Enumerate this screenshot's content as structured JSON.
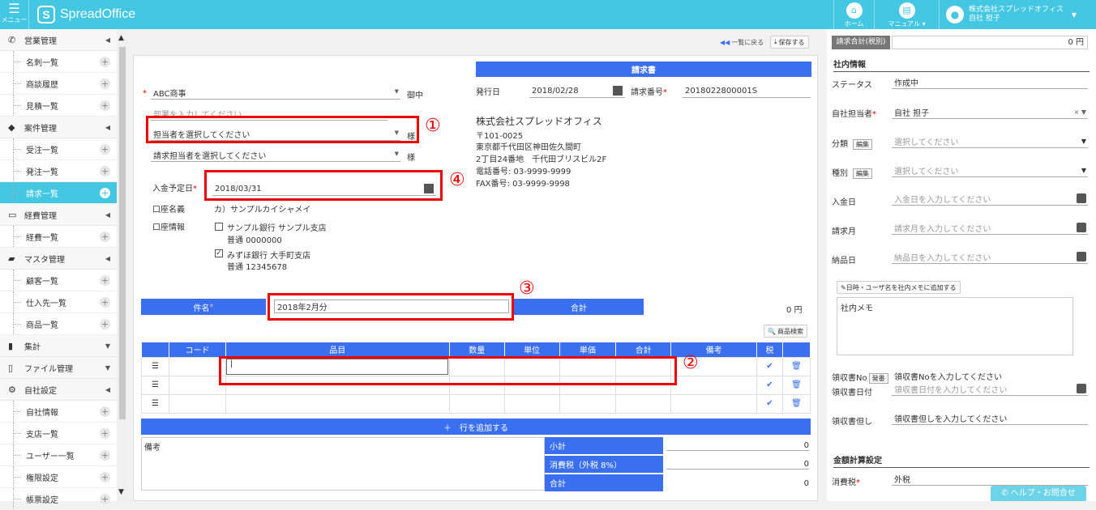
{
  "topbar": {
    "menu_label": "メニュー",
    "logo_text": "SpreadOffice",
    "logo_mark": "S",
    "home_label": "ホーム",
    "manual_label": "マニュアル ▾",
    "company": "株式会社スプレッドオフィス",
    "user": "自社 担子"
  },
  "sidebar": {
    "groups": [
      {
        "label": "営業管理",
        "icon": "phone-icon",
        "items": [
          "名刺一覧",
          "商談履歴",
          "見積一覧"
        ]
      },
      {
        "label": "案件管理",
        "icon": "tag-icon",
        "items": [
          "受注一覧",
          "発注一覧",
          "請求一覧"
        ]
      },
      {
        "label": "経費管理",
        "icon": "card-icon",
        "items": [
          "経費一覧"
        ]
      },
      {
        "label": "マスタ管理",
        "icon": "folder-icon",
        "items": [
          "顧客一覧",
          "仕入先一覧",
          "商品一覧"
        ]
      },
      {
        "label": "集計",
        "icon": "chart-icon",
        "items": []
      },
      {
        "label": "ファイル管理",
        "icon": "file-icon",
        "items": []
      },
      {
        "label": "自社設定",
        "icon": "gear-icon",
        "items": [
          "自社情報",
          "支店一覧",
          "ユーザー一覧",
          "権限設定",
          "帳票設定"
        ]
      }
    ],
    "active_item": "請求一覧"
  },
  "toolbar": {
    "back": "一覧に戻る",
    "save": "保存する"
  },
  "invoice": {
    "title": "請求書",
    "issue_date_label": "発行日",
    "issue_date": "2018/02/28",
    "number_label": "請求番号",
    "number": "2018022800001S",
    "customer": "ABC商事",
    "onchu": "御中",
    "dept_ph": "部署を入力してください",
    "contact_ph": "担当者を選択してください",
    "sama": "様",
    "billing_contact_ph": "請求担当者を選択してください",
    "company_name": "株式会社スプレッドオフィス",
    "postal": "〒101-0025",
    "addr1": "東京都千代田区神田佐久間町",
    "addr2": "2丁目24番地　千代田ブリスビル2F",
    "tel": "電話番号:  03-9999-9999",
    "fax": "FAX番号:  03-9999-9998",
    "pay_date_label": "入金予定日",
    "pay_date": "2018/03/31",
    "account_name_label": "口座名義",
    "account_name": "カ）サンプルカイシャメイ",
    "account_info_label": "口座情報",
    "bank1_line1": "サンプル銀行 サンプル支店",
    "bank1_line2": "普通 0000000",
    "bank2_line1": "みずほ銀行 大手町支店",
    "bank2_line2": "普通 12345678",
    "subject_label": "件名",
    "subject": "2018年2月分",
    "total_label": "合計",
    "total": "0 円",
    "product_search": "商品検索",
    "columns": [
      "コード",
      "品目",
      "数量",
      "単位",
      "単価",
      "合計",
      "備考",
      "税"
    ],
    "add_row": "＋　行を追加する",
    "remarks_label": "備考",
    "subtotal_label": "小計",
    "subtotal": "0",
    "tax_label": "消費税（外税 8%）",
    "tax": "0",
    "grand_label": "合計",
    "grand": "0"
  },
  "annotations": {
    "n1": "①",
    "n2": "②",
    "n3": "③",
    "n4": "④"
  },
  "right": {
    "sum_label": "請求合計(税別)",
    "sum_value": "0 円",
    "section1": "社内情報",
    "status_label": "ステータス",
    "status": "作成中",
    "owner_label": "自社担当者",
    "owner": "自社 担子",
    "category_label": "分類",
    "edit": "編集",
    "select_ph": "選択してください",
    "type_label": "種別",
    "paid_label": "入金日",
    "paid_ph": "入金日を入力してください",
    "month_label": "請求月",
    "month_ph": "請求月を入力してください",
    "delivery_label": "納品日",
    "delivery_ph": "納品日を入力してください",
    "memo_btn": "日時・ユーザ名を社内メモに追加する",
    "memo": "社内メモ",
    "receipt_no_label": "領収書No",
    "issue_btn": "発番",
    "receipt_no_ph": "領収書Noを入力してください",
    "receipt_date_label": "領収書日付",
    "receipt_date_ph": "領収書日付を入力してください",
    "receipt_note_label": "領収書但し",
    "receipt_note_ph": "領収書但しを入力してください",
    "section2": "金額計算設定",
    "tax_label": "消費税",
    "tax_value": "外税"
  },
  "help": "ヘルプ・お問合せ"
}
